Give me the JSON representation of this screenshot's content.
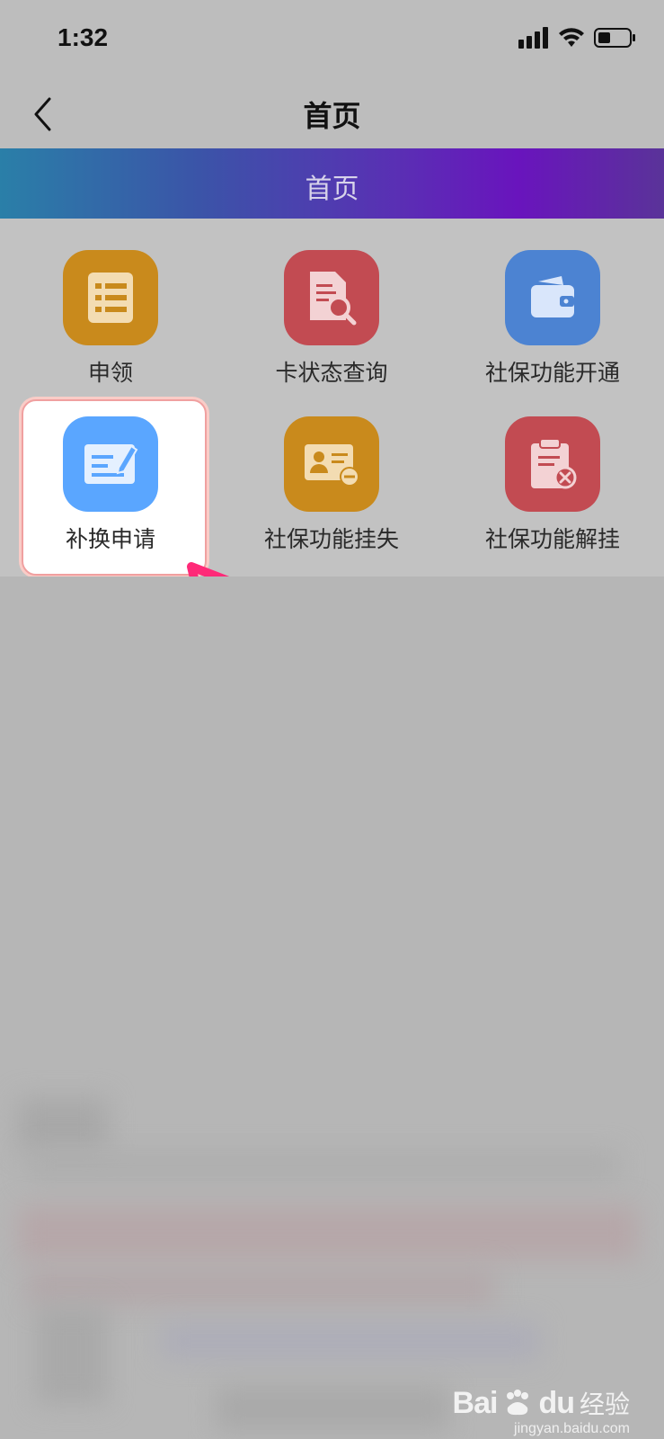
{
  "status_bar": {
    "time": "1:32"
  },
  "nav": {
    "title": "首页"
  },
  "banner": {
    "title": "首页"
  },
  "tiles": [
    {
      "label": "申领",
      "color": "#c98a1c",
      "icon": "list-icon"
    },
    {
      "label": "卡状态查询",
      "color": "#c24b52",
      "icon": "document-search-icon"
    },
    {
      "label": "社保功能开通",
      "color": "#4c83d2",
      "icon": "wallet-icon"
    },
    {
      "label": "补换申请",
      "color": "#5aa6ff",
      "icon": "edit-card-icon"
    },
    {
      "label": "社保功能挂失",
      "color": "#c98a1c",
      "icon": "id-card-remove-icon"
    },
    {
      "label": "社保功能解挂",
      "color": "#c24b52",
      "icon": "clipboard-cancel-icon"
    }
  ],
  "watermark": {
    "brand": "Bai",
    "brand2": "du",
    "cn": "经验",
    "url": "jingyan.baidu.com"
  },
  "colors": {
    "highlight_border": "#f0a0a0",
    "arrow": "#ff2a78"
  }
}
